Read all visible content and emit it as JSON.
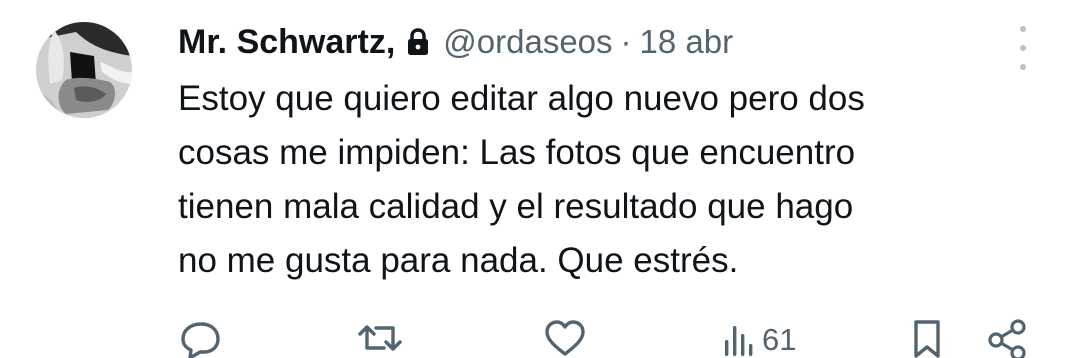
{
  "tweet": {
    "author": {
      "display_name": "Mr. Schwartz,",
      "handle": "@ordaseos",
      "protected_icon": "lock-icon"
    },
    "separator": "·",
    "date": "18 abr",
    "text_lines": [
      "Estoy que quiero editar algo nuevo pero dos",
      "cosas me impiden: Las fotos que encuentro",
      "tienen mala calidad y el resultado que hago",
      "no me gusta para nada. Que estrés."
    ],
    "actions": {
      "reply_icon": "reply-icon",
      "retweet_icon": "retweet-icon",
      "like_icon": "heart-icon",
      "views_icon": "views-icon",
      "views_count": "61",
      "bookmark_icon": "bookmark-icon",
      "share_icon": "share-icon"
    },
    "menu_icon": "more-icon"
  },
  "colors": {
    "text_primary": "#0f1419",
    "text_secondary": "#536471",
    "menu_dots": "#b9c0c6",
    "background": "#ffffff"
  }
}
